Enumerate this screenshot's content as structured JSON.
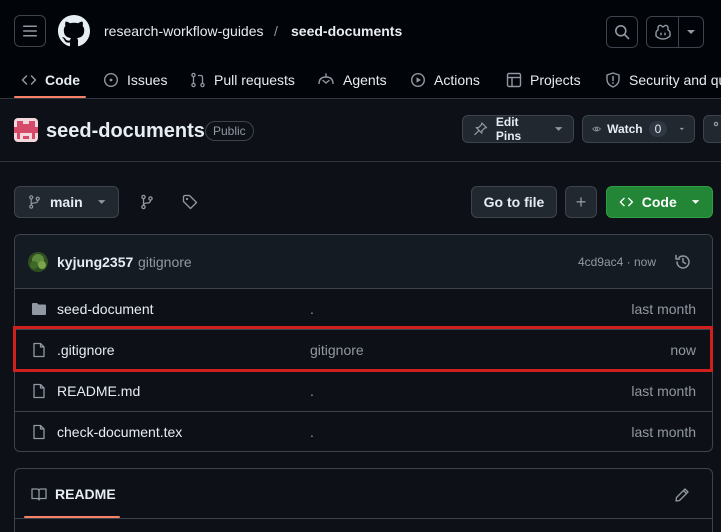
{
  "breadcrumb": {
    "owner": "research-workflow-guides",
    "separator": "/",
    "repo": "seed-documents"
  },
  "tabs": [
    {
      "label": "Code",
      "icon": "code-icon",
      "active": true
    },
    {
      "label": "Issues",
      "icon": "issue-opened-icon"
    },
    {
      "label": "Pull requests",
      "icon": "git-pull-request-icon"
    },
    {
      "label": "Agents",
      "icon": "agent-icon"
    },
    {
      "label": "Actions",
      "icon": "play-icon"
    },
    {
      "label": "Projects",
      "icon": "table-icon"
    },
    {
      "label": "Security and quality",
      "icon": "shield-icon"
    }
  ],
  "repo": {
    "name": "seed-documents",
    "visibility": "Public",
    "edit_pins_label": "Edit Pins",
    "watch_label": "Watch",
    "watch_count": "0"
  },
  "branch_bar": {
    "branch": "main",
    "go_to_file": "Go to file",
    "add_file": "+",
    "code_button": "Code"
  },
  "latest_commit": {
    "user": "kyjung2357",
    "message": "gitignore",
    "sha_time": "4cd9ac4 · now"
  },
  "files": [
    {
      "type": "folder",
      "name": "seed-document",
      "message": ".",
      "date": "last month"
    },
    {
      "type": "file",
      "name": ".gitignore",
      "message": "gitignore",
      "date": "now"
    },
    {
      "type": "file",
      "name": "README.md",
      "message": ".",
      "date": "last month"
    },
    {
      "type": "file",
      "name": "check-document.tex",
      "message": ".",
      "date": "last month"
    }
  ],
  "readme": {
    "tab_label": "README"
  },
  "colors": {
    "accent_underline": "#f78166",
    "code_button_green": "#238636",
    "highlight_red": "#d0201d"
  }
}
